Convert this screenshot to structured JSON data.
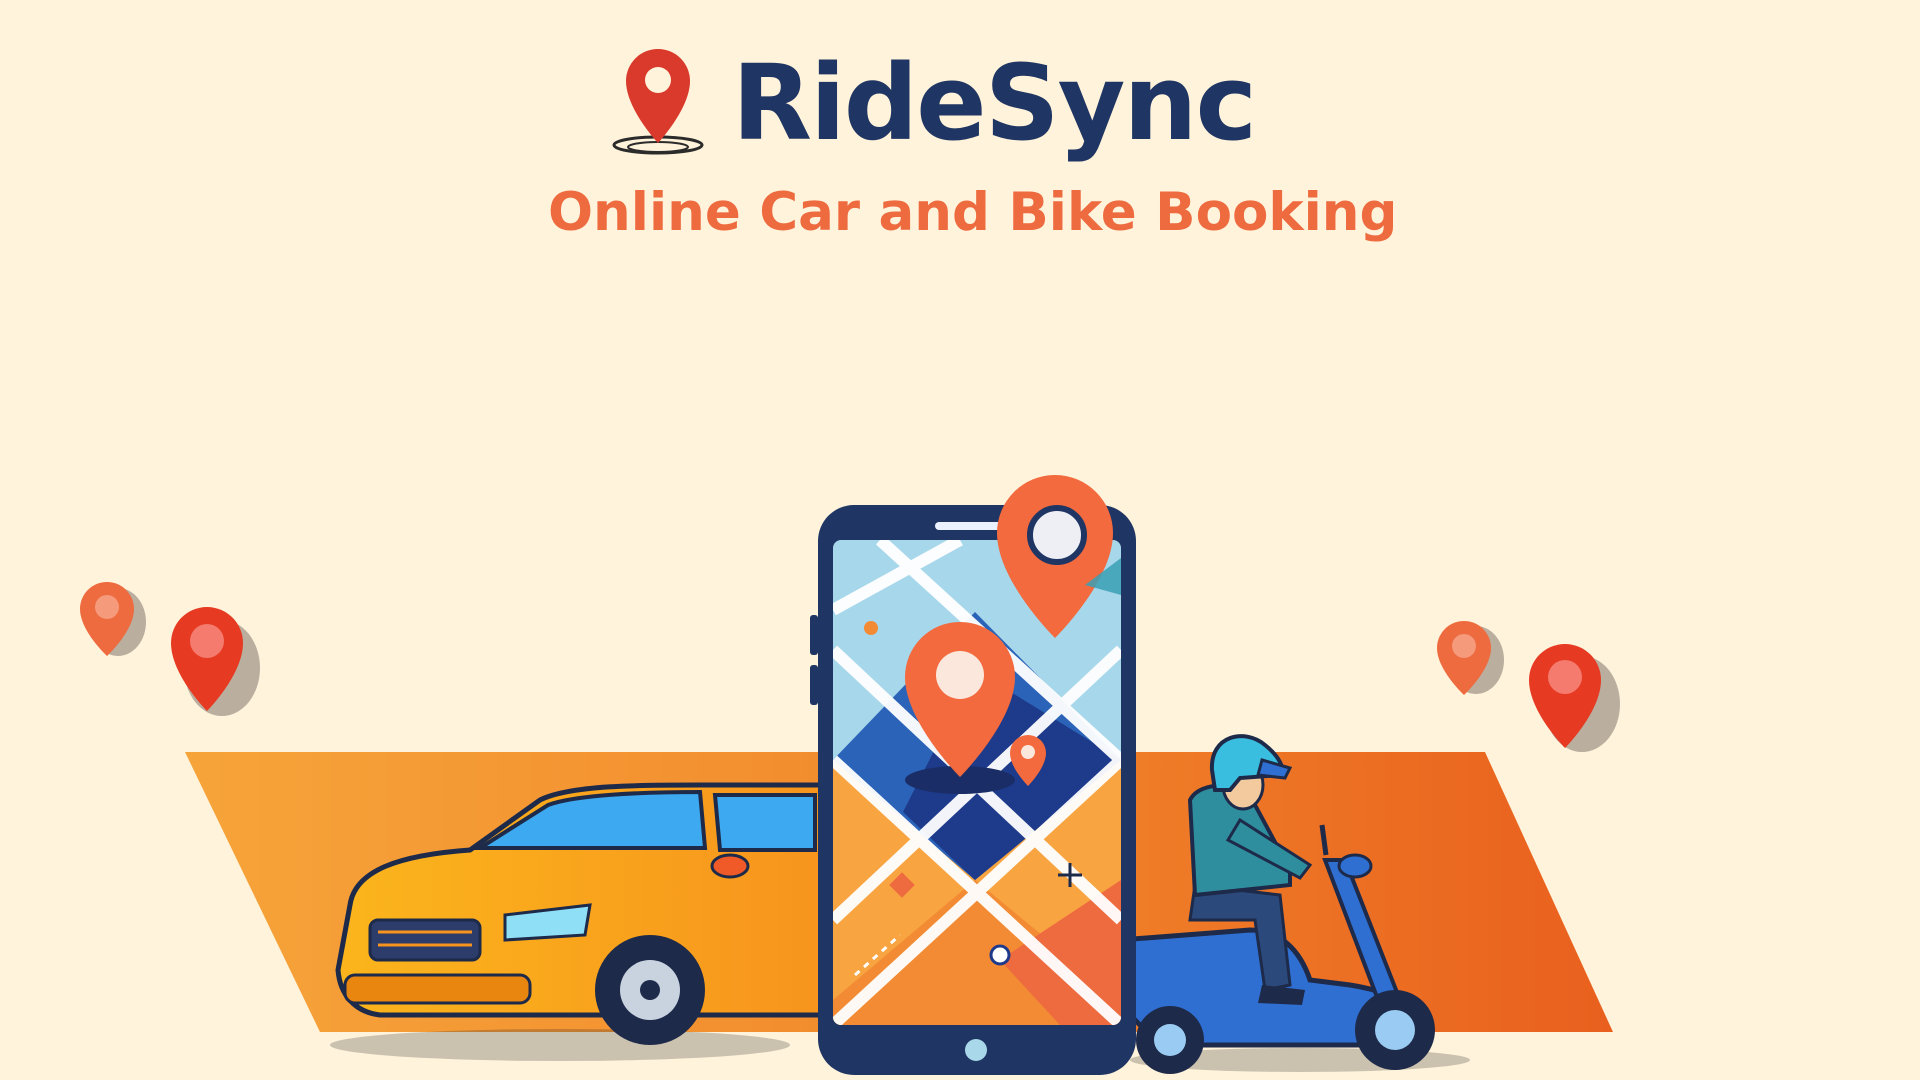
{
  "brand": {
    "name": "RideSync",
    "tagline": "Online Car and Bike Booking",
    "logo_icon": "location-pin-icon"
  },
  "colors": {
    "background": "#FFF3DB",
    "brand_navy": "#1F3563",
    "accent_orange": "#EE6A3F",
    "pin_red": "#D93A2B",
    "road_orange": "#F08A2A",
    "car_yellow": "#F9A51A",
    "scooter_blue": "#2F6FD1"
  },
  "illustration": {
    "items": [
      "smartphone-map-icon",
      "car-icon",
      "scooter-rider-icon",
      "map-pin-icon"
    ]
  }
}
